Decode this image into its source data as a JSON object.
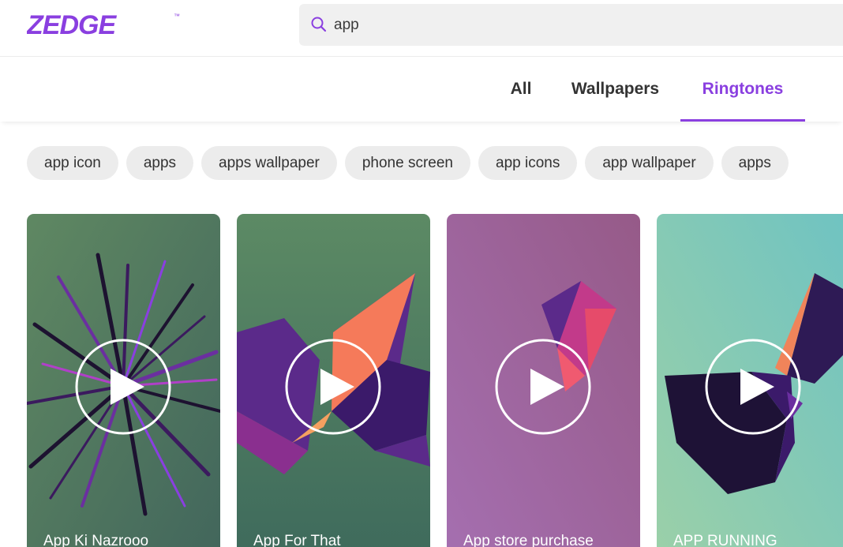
{
  "brand": {
    "logo_text": "ZEDGE",
    "trademark": "™",
    "color": "#8a3fe0"
  },
  "search": {
    "value": "app",
    "icon": "search-icon"
  },
  "tabs": [
    {
      "label": "All",
      "active": false
    },
    {
      "label": "Wallpapers",
      "active": false
    },
    {
      "label": "Ringtones",
      "active": true
    }
  ],
  "chips": [
    "app icon",
    "apps",
    "apps wallpaper",
    "phone screen",
    "app icons",
    "app wallpaper",
    "apps"
  ],
  "cards": [
    {
      "title": "App Ki Nazrooo",
      "icon": "play-icon"
    },
    {
      "title": "App For That",
      "icon": "play-icon"
    },
    {
      "title": "App store purchase",
      "icon": "play-icon"
    },
    {
      "title": "APP RUNNING",
      "icon": "play-icon"
    }
  ]
}
